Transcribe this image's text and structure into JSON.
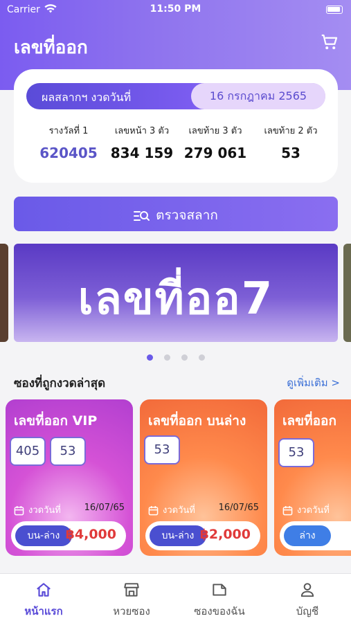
{
  "status": {
    "carrier": "Carrier",
    "time": "11:50 PM"
  },
  "app": {
    "title": "เลขที่ออก"
  },
  "result": {
    "draw_label": "ผลสลากฯ งวดวันที่",
    "draw_date": "16 กรกฎาคม 2565",
    "prizes": [
      {
        "label": "รางวัลที่ 1",
        "value": "620405"
      },
      {
        "label": "เลขหน้า 3 ตัว",
        "value": "834  159"
      },
      {
        "label": "เลขท้าย 3 ตัว",
        "value": "279  061"
      },
      {
        "label": "เลขท้าย 2 ตัว",
        "value": "53"
      }
    ]
  },
  "check_button": {
    "label": "ตรวจสลาก"
  },
  "banner": {
    "logo_text": "เลขที่ออ7"
  },
  "carousel": {
    "count": 4,
    "active_index": 0
  },
  "section": {
    "title": "ซองที่ถูกงวดล่าสุด",
    "see_more": "ดูเพิ่มเติม >"
  },
  "tickets": [
    {
      "title": "เลขที่ออก VIP",
      "numbers": [
        "405",
        "53"
      ],
      "date_label": "งวดวันที่",
      "date": "16/07/65",
      "type": "บน-ล่าง",
      "price": "฿4,000",
      "theme": "vip"
    },
    {
      "title": "เลขที่ออก บนล่าง",
      "numbers": [
        "53"
      ],
      "date_label": "งวดวันที่",
      "date": "16/07/65",
      "type": "บน-ล่าง",
      "price": "฿2,000",
      "theme": "orange"
    },
    {
      "title": "เลขที่ออก",
      "numbers": [
        "53"
      ],
      "date_label": "งวดวันที่",
      "date": "",
      "type": "ล่าง",
      "price": "",
      "theme": "orange"
    }
  ],
  "tabs": [
    {
      "label": "หน้าแรก",
      "icon": "home-icon",
      "active": true
    },
    {
      "label": "หวยซอง",
      "icon": "store-icon",
      "active": false
    },
    {
      "label": "ซองของฉัน",
      "icon": "folder-icon",
      "active": false
    },
    {
      "label": "บัญชี",
      "icon": "user-icon",
      "active": false
    }
  ],
  "colors": {
    "primary": "#6a5ae8",
    "accent_blue": "#4a4fd0",
    "price_red": "#e03a3a",
    "vip_pink": "#d552d6",
    "orange": "#ff8a4c"
  }
}
